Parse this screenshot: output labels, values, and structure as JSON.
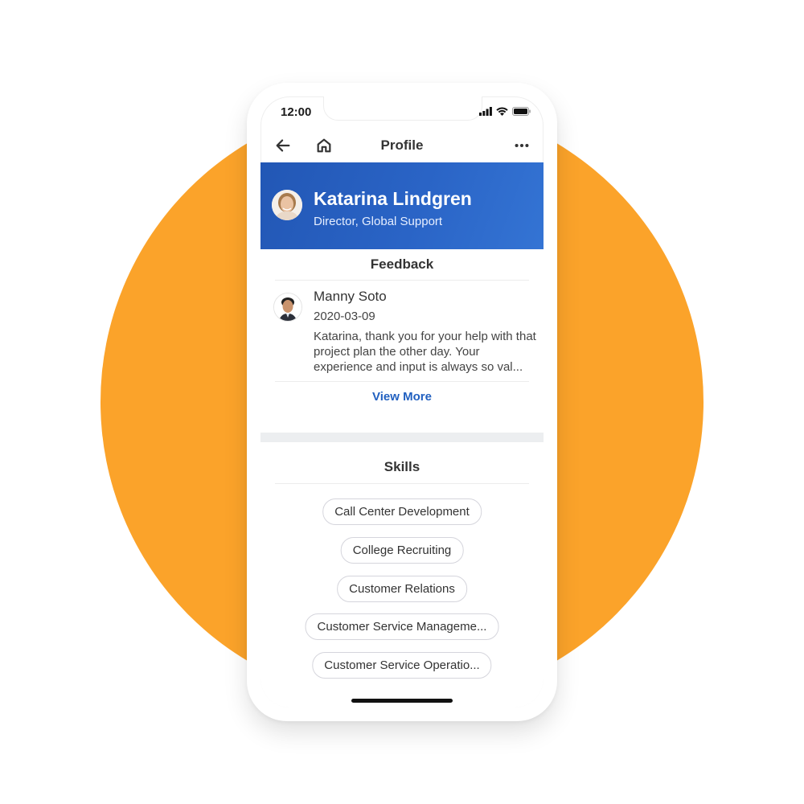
{
  "status_bar": {
    "time": "12:00",
    "icons": [
      "signal-icon",
      "wifi-icon",
      "battery-icon"
    ]
  },
  "nav": {
    "title": "Profile",
    "back_icon": "arrow-left-icon",
    "home_icon": "home-icon",
    "more_icon": "more-horizontal-icon"
  },
  "profile": {
    "name": "Katarina Lindgren",
    "role": "Director, Global Support",
    "header_color": "#2a64c6"
  },
  "feedback": {
    "title": "Feedback",
    "item": {
      "author": "Manny Soto",
      "date": "2020-03-09",
      "text": "Katarina, thank you for your help with that project plan the other day. Your experience and input is always so val..."
    },
    "view_more_label": "View More",
    "link_color": "#2160c0"
  },
  "skills": {
    "title": "Skills",
    "items": [
      "Call Center Development",
      "College Recruiting",
      "Customer Relations",
      "Customer Service Manageme...",
      "Customer Service Operatio..."
    ]
  },
  "background": {
    "circle_color": "#fba32a"
  }
}
